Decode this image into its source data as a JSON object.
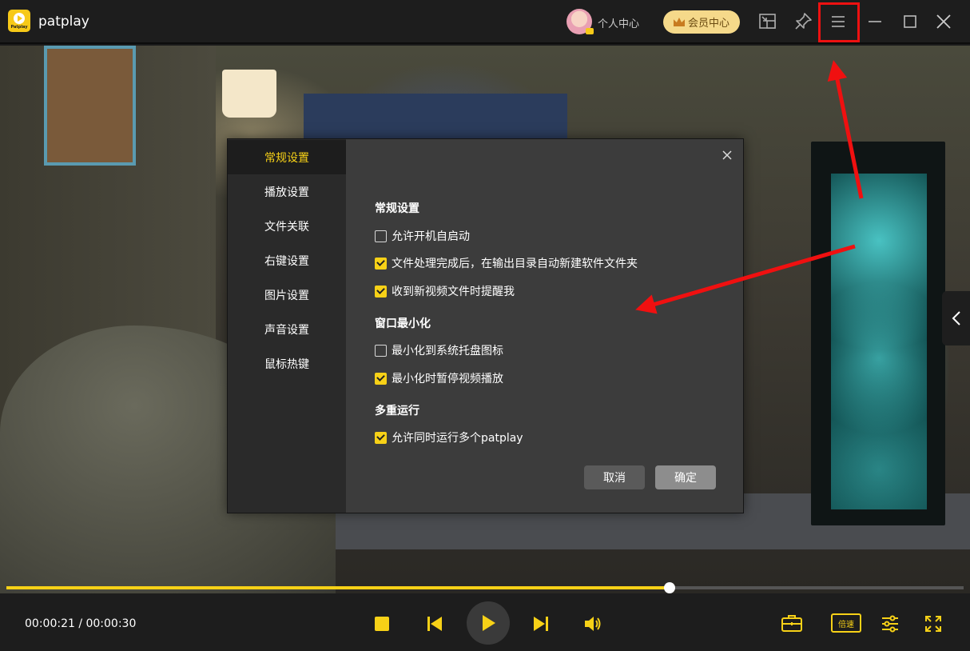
{
  "app": {
    "title": "patplay",
    "logo_text": "Patplay",
    "personal_center": "个人中心",
    "vip_center": "会员中心",
    "icons": [
      "picture-in-picture-icon",
      "pin-icon",
      "menu-icon",
      "minimize-icon",
      "maximize-icon",
      "close-icon"
    ]
  },
  "settings": {
    "tabs": [
      {
        "label": "常规设置",
        "active": true
      },
      {
        "label": "播放设置"
      },
      {
        "label": "文件关联"
      },
      {
        "label": "右键设置"
      },
      {
        "label": "图片设置"
      },
      {
        "label": "声音设置"
      },
      {
        "label": "鼠标热键"
      }
    ],
    "sections": [
      {
        "title": "常规设置",
        "options": [
          {
            "label": "允许开机自启动",
            "checked": false
          },
          {
            "label": "文件处理完成后，在输出目录自动新建软件文件夹",
            "checked": true
          },
          {
            "label": "收到新视频文件时提醒我",
            "checked": true
          }
        ]
      },
      {
        "title": "窗口最小化",
        "options": [
          {
            "label": "最小化到系统托盘图标",
            "checked": false
          },
          {
            "label": "最小化时暂停视频播放",
            "checked": true
          }
        ]
      },
      {
        "title": "多重运行",
        "options": [
          {
            "label": "允许同时运行多个patplay",
            "checked": true
          }
        ]
      }
    ],
    "cancel_label": "取消",
    "ok_label": "确定"
  },
  "player": {
    "time": "00:00:21 / 00:00:30",
    "progress": 0.693,
    "speed_label": "倍速",
    "accent": "#f7d117"
  }
}
